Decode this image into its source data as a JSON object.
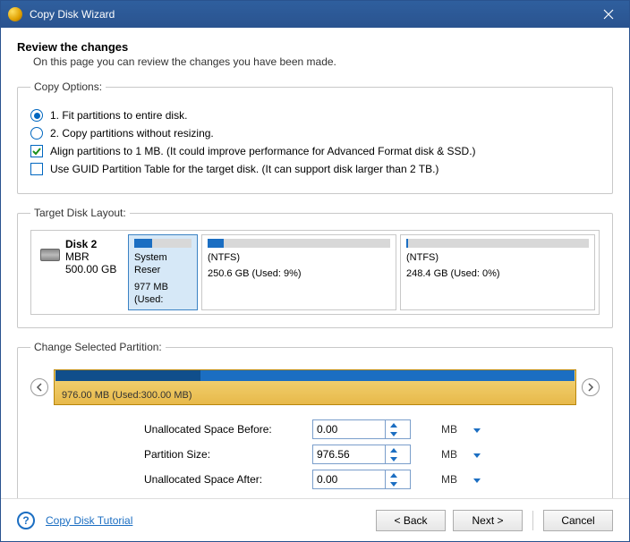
{
  "window": {
    "title": "Copy Disk Wizard"
  },
  "header": {
    "title": "Review the changes",
    "subtitle": "On this page you can review the changes you have been made."
  },
  "copy_options": {
    "legend": "Copy Options:",
    "radio1": "1. Fit partitions to entire disk.",
    "radio2": "2. Copy partitions without resizing.",
    "check_align": "Align partitions to 1 MB.  (It could improve performance for Advanced Format disk & SSD.)",
    "check_guid": "Use GUID Partition Table for the target disk. (It can support disk larger than 2 TB.)"
  },
  "layout": {
    "legend": "Target Disk Layout:",
    "disk": {
      "name": "Disk 2",
      "type": "MBR",
      "size": "500.00 GB"
    },
    "partitions": [
      {
        "label": "System Reser",
        "size_line": "977 MB (Used:",
        "fill_pct": 32
      },
      {
        "label": "(NTFS)",
        "size_line": "250.6 GB (Used: 9%)",
        "fill_pct": 9
      },
      {
        "label": "(NTFS)",
        "size_line": "248.4 GB (Used: 0%)",
        "fill_pct": 1
      }
    ]
  },
  "change": {
    "legend": "Change Selected Partition:",
    "slider_label": "976.00 MB (Used:300.00 MB)",
    "rows": {
      "before_label": "Unallocated Space Before:",
      "before_value": "0.00",
      "size_label": "Partition Size:",
      "size_value": "976.56",
      "after_label": "Unallocated Space After:",
      "after_value": "0.00",
      "unit": "MB"
    }
  },
  "footer": {
    "tutorial": "Copy Disk Tutorial",
    "back": "< Back",
    "next": "Next >",
    "cancel": "Cancel"
  }
}
